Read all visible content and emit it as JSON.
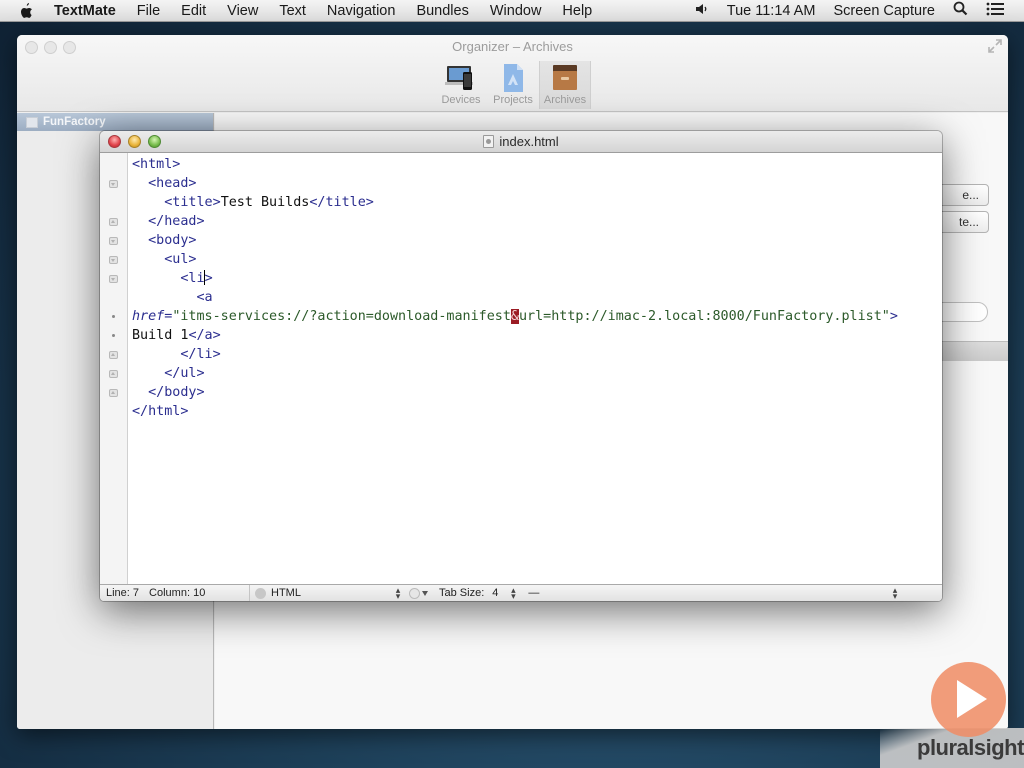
{
  "menubar": {
    "app_name": "TextMate",
    "menus": [
      "File",
      "Edit",
      "View",
      "Text",
      "Navigation",
      "Bundles",
      "Window",
      "Help"
    ],
    "volume_icon": "speaker-icon",
    "clock": "Tue 11:14 AM",
    "status_app": "Screen Capture",
    "search_icon": "spotlight-search-icon",
    "list_icon": "notification-list-icon"
  },
  "organizer": {
    "title": "Organizer – Archives",
    "toolbar": [
      {
        "label": "Devices",
        "icon": "devices-icon",
        "active": false
      },
      {
        "label": "Projects",
        "icon": "projects-icon",
        "active": false
      },
      {
        "label": "Archives",
        "icon": "archives-icon",
        "active": true
      }
    ],
    "sidebar": {
      "items": [
        {
          "label": "FunFactory",
          "selected": true
        }
      ]
    },
    "buttons": [
      "e...",
      "te..."
    ]
  },
  "editor_window": {
    "title": "index.html",
    "lines": [
      {
        "gutter": "none",
        "html": "<span class=\"tag\">&lt;html&gt;</span>"
      },
      {
        "gutter": "fold-down",
        "html": "  <span class=\"tag\">&lt;head&gt;</span>"
      },
      {
        "gutter": "none",
        "html": "    <span class=\"tag\">&lt;title&gt;</span>Test Builds<span class=\"tag\">&lt;/title&gt;</span>"
      },
      {
        "gutter": "fold-up",
        "html": "  <span class=\"tag\">&lt;/head&gt;</span>"
      },
      {
        "gutter": "fold-down",
        "html": "  <span class=\"tag\">&lt;body&gt;</span>"
      },
      {
        "gutter": "fold-down",
        "html": "    <span class=\"tag\">&lt;ul&gt;</span>"
      },
      {
        "gutter": "fold-down",
        "html": "      <span class=\"tag\">&lt;li</span><span class=\"caret\"></span><span class=\"tag\">&gt;</span>"
      },
      {
        "gutter": "none",
        "html": "        <span class=\"tag\">&lt;a</span>"
      },
      {
        "gutter": "dot",
        "html": "<span class=\"attr\">href</span><span class=\"tag\">=</span><span class=\"str\">\"itms-services://?action=download-manifest<span class=\"ent\">&amp;</span>url=http://imac-2.local:8000/FunFactory.plist\"</span><span class=\"tag\">&gt;</span>"
      },
      {
        "gutter": "dot",
        "html": "Build 1<span class=\"tag\">&lt;/a&gt;</span>"
      },
      {
        "gutter": "fold-up",
        "html": "      <span class=\"tag\">&lt;/li&gt;</span>"
      },
      {
        "gutter": "fold-up",
        "html": "    <span class=\"tag\">&lt;/ul&gt;</span>"
      },
      {
        "gutter": "fold-up",
        "html": "  <span class=\"tag\">&lt;/body&gt;</span>"
      },
      {
        "gutter": "none",
        "html": "<span class=\"tag\">&lt;/html&gt;</span>"
      }
    ],
    "status": {
      "line_label": "Line:",
      "line": "7",
      "column_label": "Column:",
      "column": "10",
      "language": "HTML",
      "tab_size_label": "Tab Size:",
      "tab_size": "4",
      "symbol": "—"
    }
  },
  "watermark": {
    "brand": "pluralsight",
    "icon": "play-icon"
  },
  "colors": {
    "tag": "#2b2e8f",
    "string": "#2c5a2a",
    "entity_highlight": "#9b1c24",
    "selected_sidebar": "#9cadc2",
    "watermark_accent": "#f08c64"
  }
}
